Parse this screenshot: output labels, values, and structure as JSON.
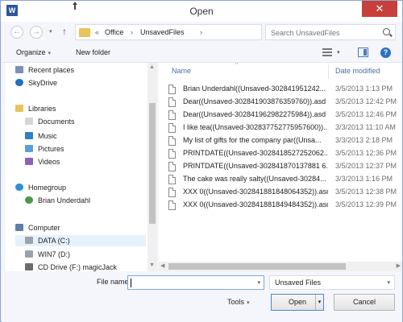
{
  "window": {
    "title": "Open",
    "app_icon": "W",
    "close_symbol": "✕"
  },
  "nav": {
    "back_icon": "←",
    "forward_icon": "→",
    "recent_drop": "▾",
    "up_icon": "↑",
    "address": {
      "prefix": "«",
      "crumbs": [
        "Office",
        "UnsavedFiles"
      ],
      "sep": "›"
    },
    "search_placeholder": "Search UnsavedFiles",
    "refresh_icon": "↻"
  },
  "toolbar": {
    "organize_label": "Organize",
    "new_folder_label": "New folder",
    "drop": "▾",
    "help_label": "?"
  },
  "sidebar": {
    "items": [
      {
        "label": "Recent places",
        "icon": "recent-places-icon",
        "color": "#7b8fb8"
      },
      {
        "label": "SkyDrive",
        "icon": "skydrive-icon",
        "color": "#1f6fc5"
      },
      {
        "label": "Libraries",
        "icon": "libraries-icon",
        "color": "#e8c45a"
      },
      {
        "label": "Documents",
        "icon": "documents-icon",
        "color": "#c9c9c9"
      },
      {
        "label": "Music",
        "icon": "music-icon",
        "color": "#2f7fc6"
      },
      {
        "label": "Pictures",
        "icon": "pictures-icon",
        "color": "#5a9fd6"
      },
      {
        "label": "Videos",
        "icon": "videos-icon",
        "color": "#8a63b5"
      },
      {
        "label": "Homegroup",
        "icon": "homegroup-icon",
        "color": "#2f8fd6"
      },
      {
        "label": "Brian Underdahl",
        "icon": "user-icon",
        "color": "#4a9a4a"
      },
      {
        "label": "Computer",
        "icon": "computer-icon",
        "color": "#5f7ea8"
      },
      {
        "label": "DATA (C:)",
        "icon": "drive-icon",
        "color": "#9aa3ad"
      },
      {
        "label": "WIN7 (D:)",
        "icon": "drive-icon",
        "color": "#9aa3ad"
      },
      {
        "label": "CD Drive (F:) magicJack",
        "icon": "cd-drive-icon",
        "color": "#6b6b6b"
      }
    ],
    "scroll_up": "▲",
    "scroll_down": "▼"
  },
  "files": {
    "columns": {
      "name": "Name",
      "date": "Date modified",
      "sort": "^"
    },
    "rows": [
      {
        "name": "Brian Underdahl((Unsaved-302841951242...",
        "date": "3/5/2013 1:13 PM"
      },
      {
        "name": "Dear((Unsaved-302841903876359760)).asd",
        "date": "3/5/2013 12:42 PM"
      },
      {
        "name": "Dear((Unsaved-302841962982275984)).asd",
        "date": "3/5/2013 12:46 PM"
      },
      {
        "name": "I like tea((Unsaved-302837752775957600))...",
        "date": "3/3/2013 11:10 AM"
      },
      {
        "name": "My list of gifts for the company par((Unsa...",
        "date": "3/3/2013 2:18 PM"
      },
      {
        "name": "PRINTDATE((Unsaved-3028418527252062...",
        "date": "3/5/2013 12:36 PM"
      },
      {
        "name": "PRINTDATE((Unsaved-302841870137881 6...",
        "date": "3/5/2013 12:37 PM"
      },
      {
        "name": "The cake was really salty((Unsaved-30284...",
        "date": "3/3/2013 1:16 PM"
      },
      {
        "name": "XXX 0((Unsaved-302841881848064352)).asd",
        "date": "3/5/2013 12:38 PM"
      },
      {
        "name": "XXX 0((Unsaved-302841881849484352)).asd",
        "date": "3/5/2013 12:39 PM"
      }
    ],
    "scroll_left": "◀",
    "scroll_right": "▶"
  },
  "bottom": {
    "file_name_label": "File name:",
    "file_name_value": "",
    "file_type": "Unsaved Files",
    "drop": "▾",
    "tools_label": "Tools",
    "open_label": "Open",
    "cancel_label": "Cancel"
  }
}
